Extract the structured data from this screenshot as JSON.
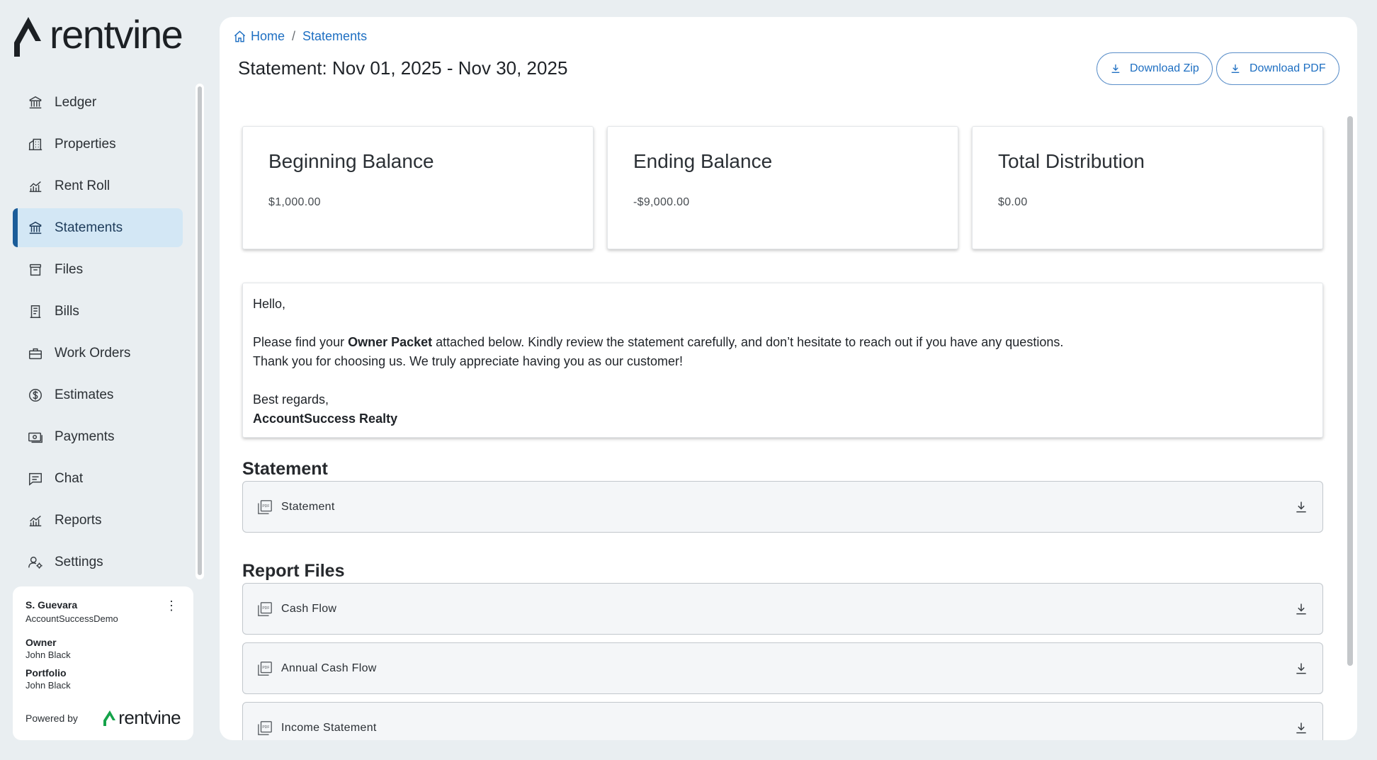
{
  "brand": {
    "name": "rentvine",
    "accent": "#1b5c99",
    "logo_green": "#15a34a"
  },
  "sidebar": {
    "items": [
      {
        "label": "Ledger",
        "icon": "bank-icon",
        "active": false
      },
      {
        "label": "Properties",
        "icon": "building-icon",
        "active": false
      },
      {
        "label": "Rent Roll",
        "icon": "chart-icon",
        "active": false
      },
      {
        "label": "Statements",
        "icon": "bank-icon",
        "active": true
      },
      {
        "label": "Files",
        "icon": "archive-icon",
        "active": false
      },
      {
        "label": "Bills",
        "icon": "receipt-icon",
        "active": false
      },
      {
        "label": "Work Orders",
        "icon": "toolbox-icon",
        "active": false
      },
      {
        "label": "Estimates",
        "icon": "dollar-circle-icon",
        "active": false
      },
      {
        "label": "Payments",
        "icon": "cash-icon",
        "active": false
      },
      {
        "label": "Chat",
        "icon": "chat-icon",
        "active": false
      },
      {
        "label": "Reports",
        "icon": "chart-icon",
        "active": false
      },
      {
        "label": "Settings",
        "icon": "user-settings-icon",
        "active": false
      }
    ]
  },
  "user": {
    "name": "S. Guevara",
    "account": "AccountSuccessDemo",
    "owner_label": "Owner",
    "owner_value": "John Black",
    "portfolio_label": "Portfolio",
    "portfolio_value": "John Black",
    "powered_by": "Powered by",
    "menu_glyph": "⋮"
  },
  "breadcrumb": {
    "home": "Home",
    "separator": "/",
    "current": "Statements"
  },
  "page": {
    "title": "Statement: Nov 01, 2025 - Nov 30, 2025",
    "download_zip": "Download Zip",
    "download_pdf": "Download PDF"
  },
  "cards": [
    {
      "title": "Beginning Balance",
      "value": "$1,000.00"
    },
    {
      "title": "Ending Balance",
      "value": "-$9,000.00"
    },
    {
      "title": "Total Distribution",
      "value": "$0.00"
    }
  ],
  "message": {
    "greeting": "Hello,",
    "line1_pre": "Please find your ",
    "line1_bold": "Owner Packet",
    "line1_post": " attached below. Kindly review the statement carefully, and don’t hesitate to reach out if you have any questions.",
    "line2": "Thank you for choosing us. We truly appreciate having you as our customer!",
    "closing": "Best regards,",
    "signature": "AccountSuccess Realty"
  },
  "statement_section": {
    "title": "Statement",
    "files": [
      {
        "name": "Statement"
      }
    ]
  },
  "report_section": {
    "title": "Report Files",
    "files": [
      {
        "name": "Cash Flow"
      },
      {
        "name": "Annual Cash Flow"
      },
      {
        "name": "Income Statement"
      }
    ]
  }
}
